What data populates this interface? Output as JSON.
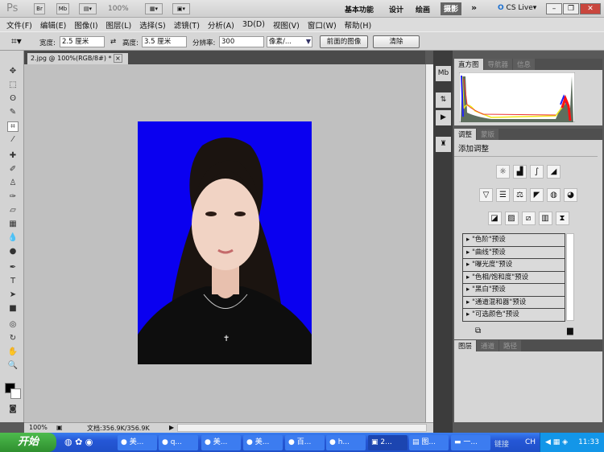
{
  "app": {
    "logo": "Ps",
    "br": "Br",
    "mb": "Mb",
    "zoom": "100%",
    "workspaces": [
      "基本功能",
      "设计",
      "绘画",
      "摄影"
    ],
    "active_workspace": "摄影",
    "more": "»",
    "cslive": "CS Live"
  },
  "menu": [
    "文件(F)",
    "编辑(E)",
    "图像(I)",
    "图层(L)",
    "选择(S)",
    "滤镜(T)",
    "分析(A)",
    "3D(D)",
    "视图(V)",
    "窗口(W)",
    "帮助(H)"
  ],
  "options": {
    "width_label": "宽度:",
    "width_value": "2.5 厘米",
    "height_label": "高度:",
    "height_value": "3.5 厘米",
    "res_label": "分辨率:",
    "res_value": "300",
    "unit": "像素/...",
    "front_image": "前面的图像",
    "clear": "清除"
  },
  "document": {
    "tab": "2.jpg @ 100%(RGB/8#) *",
    "close": "×",
    "zoom": "100%",
    "doc_info": "文档:356.9K/356.9K",
    "bg_color": "#0a00f0"
  },
  "panels": {
    "histogram_tabs": [
      "直方图",
      "导航器",
      "信息"
    ],
    "adjust_tabs": [
      "调整",
      "蒙版"
    ],
    "adjust_title": "添加调整",
    "presets": [
      "\"色阶\"预设",
      "\"曲线\"预设",
      "\"曝光度\"预设",
      "\"色相/饱和度\"预设",
      "\"黑白\"预设",
      "\"通道混和器\"预设",
      "\"可选颜色\"预设"
    ],
    "layer_tabs": [
      "图层",
      "通道",
      "路径"
    ]
  },
  "taskbar": {
    "start": "开始",
    "tasks": [
      "美...",
      "q...",
      "美...",
      "美...",
      "百...",
      "h...",
      "2...",
      "图...",
      "一..."
    ],
    "active_task": "2...",
    "links": "链接",
    "lang": "CH",
    "time": "11:33"
  }
}
